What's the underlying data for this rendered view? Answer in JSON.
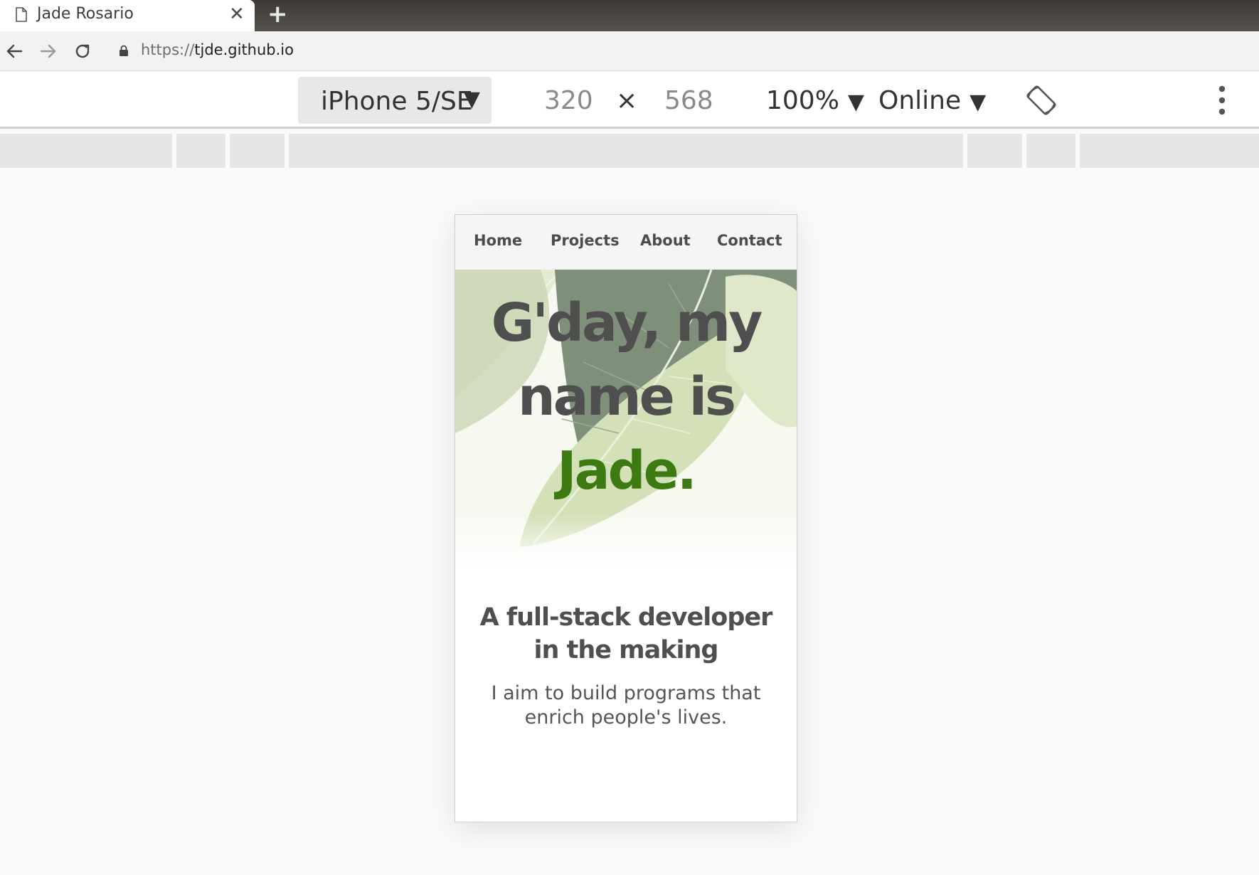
{
  "browser": {
    "tab": {
      "title": "Jade Rosario",
      "icon": "document-icon",
      "close_glyph": "✕"
    },
    "new_tab_glyph": "+",
    "address": {
      "scheme": "https://",
      "host": "tjde.github.io"
    }
  },
  "device_toolbar": {
    "device": "iPhone 5/SE",
    "width": "320",
    "times": "×",
    "height": "568",
    "zoom": "100%",
    "network": "Online",
    "arrow": "▼"
  },
  "site": {
    "nav": [
      "Home",
      "Projects",
      "About",
      "Contact"
    ],
    "hero": {
      "line1": "G'day, my",
      "line2": "name is",
      "name": "Jade."
    },
    "subtitle_line1": "A full-stack developer",
    "subtitle_line2": "in the making",
    "tagline": "I aim to build programs that enrich people's lives."
  },
  "colors": {
    "accent_green": "#3d7a12",
    "text_dark": "#4f4f4f",
    "tab_bar": "#4a4742"
  }
}
